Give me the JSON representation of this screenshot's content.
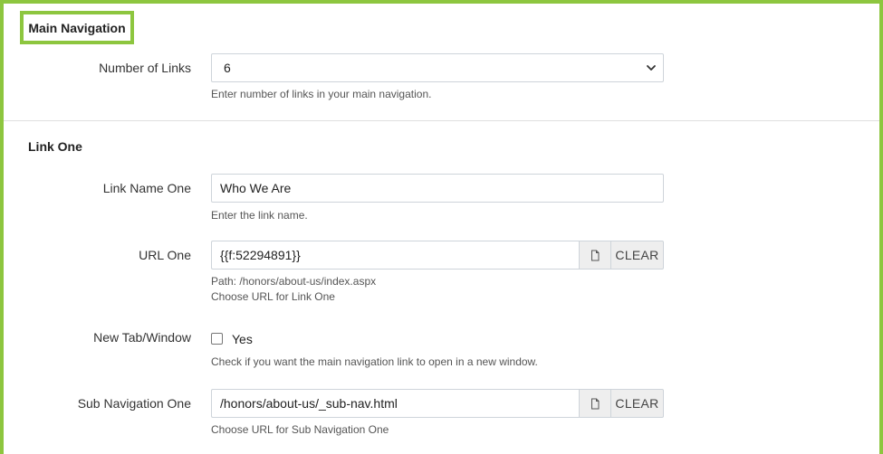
{
  "main_navigation": {
    "title": "Main Navigation",
    "number_of_links": {
      "label": "Number of Links",
      "value": "6",
      "help": "Enter number of links in your main navigation."
    }
  },
  "link_one": {
    "title": "Link One",
    "link_name": {
      "label": "Link Name One",
      "value": "Who We Are",
      "help": "Enter the link name."
    },
    "url": {
      "label": "URL One",
      "value": "{{f:52294891}}",
      "clear_label": "CLEAR",
      "path": "Path: /honors/about-us/index.aspx",
      "help": "Choose URL for Link One"
    },
    "new_tab": {
      "label": "New Tab/Window",
      "checkbox_label": "Yes",
      "checked": false,
      "help": "Check if you want the main navigation link to open in a new window."
    },
    "sub_navigation": {
      "label": "Sub Navigation One",
      "value": "/honors/about-us/_sub-nav.html",
      "clear_label": "CLEAR",
      "help": "Choose URL for Sub Navigation One"
    }
  },
  "colors": {
    "accent_border": "#8dc63f"
  },
  "icons": {
    "file_picker": "file-icon",
    "dropdown": "chevron-down-icon"
  }
}
